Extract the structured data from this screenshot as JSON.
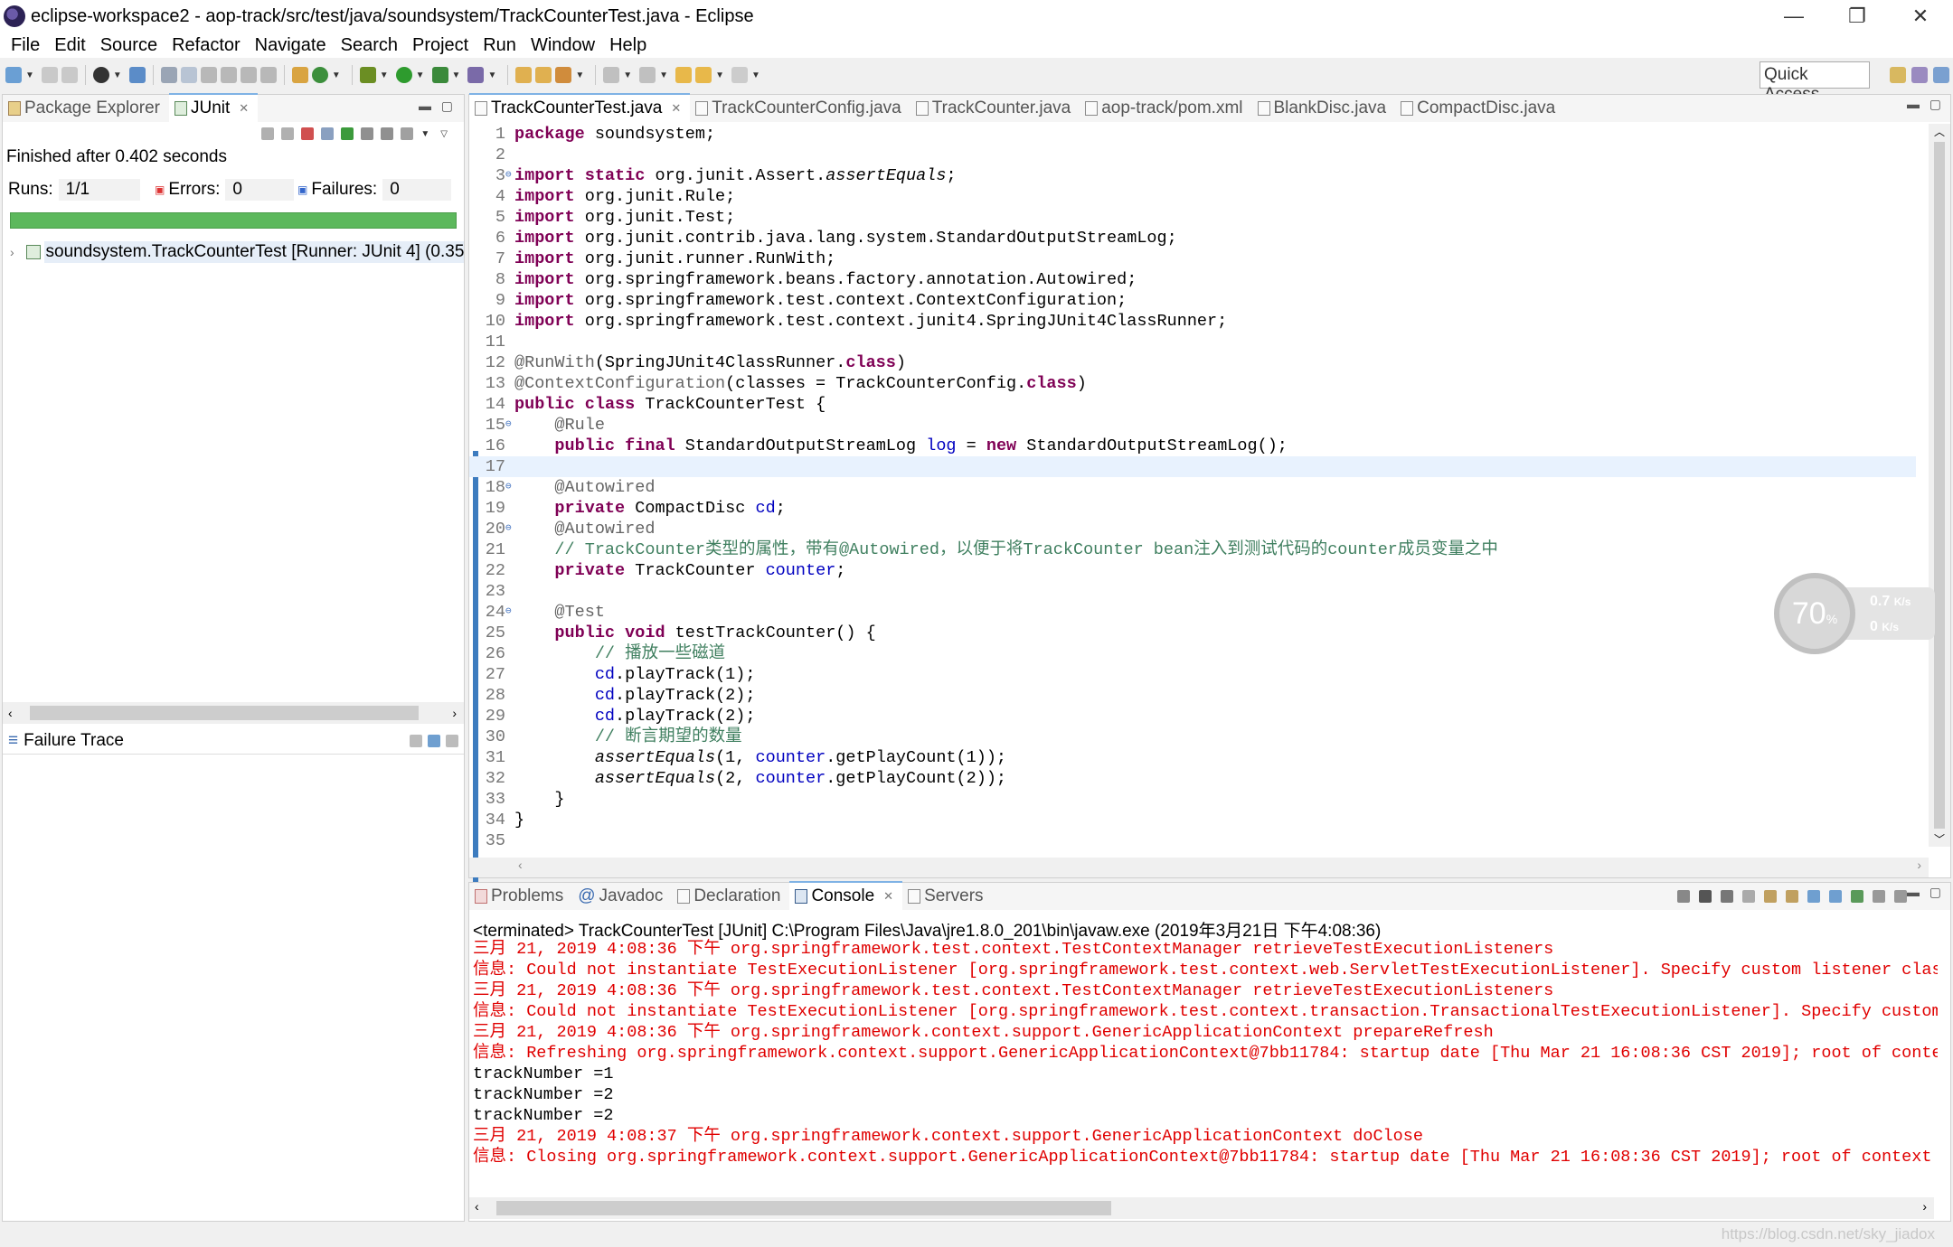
{
  "window": {
    "title": "eclipse-workspace2 - aop-track/src/test/java/soundsystem/TrackCounterTest.java - Eclipse",
    "controls": {
      "minimize": "—",
      "restore": "❐",
      "close": "✕"
    }
  },
  "menu": [
    "File",
    "Edit",
    "Source",
    "Refactor",
    "Navigate",
    "Search",
    "Project",
    "Run",
    "Window",
    "Help"
  ],
  "toolbar": {
    "quick_access": "Quick Access"
  },
  "left_panel": {
    "tabs": [
      {
        "label": "Package Explorer"
      },
      {
        "label": "JUnit",
        "close": "✕"
      }
    ],
    "finished": "Finished after 0.402 seconds",
    "runs_label": "Runs:",
    "runs_value": "1/1",
    "errors_label": "Errors:",
    "errors_value": "0",
    "failures_label": "Failures:",
    "failures_value": "0",
    "progress": 1.0,
    "tree_item": "soundsystem.TrackCounterTest [Runner: JUnit 4] (0.35",
    "failure_trace": "Failure Trace"
  },
  "editor": {
    "tabs": [
      {
        "label": "TrackCounterTest.java",
        "active": true,
        "close": "✕"
      },
      {
        "label": "TrackCounterConfig.java"
      },
      {
        "label": "TrackCounter.java"
      },
      {
        "label": "aop-track/pom.xml"
      },
      {
        "label": "BlankDisc.java"
      },
      {
        "label": "CompactDisc.java"
      }
    ],
    "lines": [
      "1",
      "2",
      "3",
      "4",
      "5",
      "6",
      "7",
      "8",
      "9",
      "10",
      "11",
      "12",
      "13",
      "14",
      "15",
      "16",
      "17",
      "18",
      "19",
      "20",
      "21",
      "22",
      "23",
      "24",
      "25",
      "26",
      "27",
      "28",
      "29",
      "30",
      "31",
      "32",
      "33",
      "34",
      "35"
    ],
    "code": {
      "l1_kw": "package",
      "l1_rest": " soundsystem;",
      "import_kw": "import",
      "static_kw": "static",
      "l3_rest": " org.junit.Assert.",
      "l3_method": "assertEquals",
      "semi": ";",
      "l4": " org.junit.Rule;",
      "l5": " org.junit.Test;",
      "l6": " org.junit.contrib.java.lang.system.StandardOutputStreamLog;",
      "l7": " org.junit.runner.RunWith;",
      "l8": " org.springframework.beans.factory.annotation.Autowired;",
      "l9": " org.springframework.test.context.ContextConfiguration;",
      "l10": " org.springframework.test.context.junit4.SpringJUnit4ClassRunner;",
      "l12_ann": "@RunWith",
      "l12_a": "(SpringJUnit4ClassRunner.",
      "class_kw": "class",
      "l12_b": ")",
      "l13_ann": "@ContextConfiguration",
      "l13_a": "(classes = TrackCounterConfig.",
      "l13_b": ")",
      "public_kw": "public",
      "l14_rest": " TrackCounterTest {",
      "l15_ann": "@Rule",
      "final_kw": "final",
      "l16_a": " StandardOutputStreamLog ",
      "l16_fld": "log",
      "l16_b": " = ",
      "new_kw": "new",
      "l16_c": " StandardOutputStreamLog();",
      "autowired": "@Autowired",
      "private_kw": "private",
      "l19_a": " CompactDisc ",
      "cd": "cd",
      "l21_cm": "// TrackCounter类型的属性，带有@Autowired，以便于将TrackCounter bean注入到测试代码的counter成员变量之中",
      "l22_a": " TrackCounter ",
      "counter": "counter",
      "l24_ann": "@Test",
      "void_kw": "void",
      "l25_a": " testTrackCounter() {",
      "l26_cm": "// 播放一些磁道",
      "play1": ".playTrack(1);",
      "play2": ".playTrack(2);",
      "l30_cm": "// 断言期望的数量",
      "assert": "assertEquals",
      "l31_a": "(1, ",
      "l31_b": ".getPlayCount(1));",
      "l32_a": "(2, ",
      "l32_b": ".getPlayCount(2));",
      "close1": "}",
      "close2": "}"
    }
  },
  "speed_widget": {
    "percent": "70",
    "percent_sign": "%",
    "up": "0.7",
    "up_unit": "K/s",
    "down": "0",
    "down_unit": "K/s"
  },
  "console": {
    "tabs": [
      {
        "label": "Problems"
      },
      {
        "label": "Javadoc"
      },
      {
        "label": "Declaration"
      },
      {
        "label": "Console",
        "active": true,
        "close": "✕"
      },
      {
        "label": "Servers"
      }
    ],
    "header": "<terminated> TrackCounterTest [JUnit] C:\\Program Files\\Java\\jre1.8.0_201\\bin\\javaw.exe (2019年3月21日 下午4:08:36)",
    "lines": [
      "三月 21, 2019 4:08:36 下午 org.springframework.test.context.TestContextManager retrieveTestExecutionListeners",
      "信息: Could not instantiate TestExecutionListener [org.springframework.test.context.web.ServletTestExecutionListener]. Specify custom listener clas",
      "三月 21, 2019 4:08:36 下午 org.springframework.test.context.TestContextManager retrieveTestExecutionListeners",
      "信息: Could not instantiate TestExecutionListener [org.springframework.test.context.transaction.TransactionalTestExecutionListener]. Specify custom",
      "三月 21, 2019 4:08:36 下午 org.springframework.context.support.GenericApplicationContext prepareRefresh",
      "信息: Refreshing org.springframework.context.support.GenericApplicationContext@7bb11784: startup date [Thu Mar 21 16:08:36 CST 2019]; root of conte",
      "trackNumber =1",
      "trackNumber =2",
      "trackNumber =2",
      "三月 21, 2019 4:08:37 下午 org.springframework.context.support.GenericApplicationContext doClose",
      "信息: Closing org.springframework.context.support.GenericApplicationContext@7bb11784: startup date [Thu Mar 21 16:08:36 CST 2019]; root of context h"
    ]
  },
  "watermark": "https://blog.csdn.net/sky_jiadox"
}
